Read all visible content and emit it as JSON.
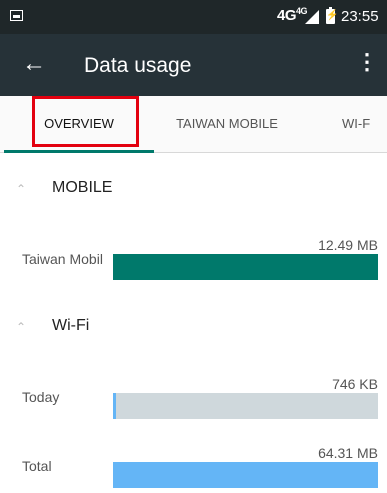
{
  "status_bar": {
    "network": "4G",
    "network_sup": "4G",
    "time": "23:55"
  },
  "app_bar": {
    "title": "Data usage",
    "back_icon": "arrow-back-icon",
    "menu_icon": "more-vert-icon"
  },
  "tabs": [
    {
      "label": "OVERVIEW",
      "active": true
    },
    {
      "label": "TAIWAN MOBILE",
      "active": false
    },
    {
      "label": "WI-F",
      "active": false
    }
  ],
  "mobile": {
    "title": "MOBILE",
    "rows": [
      {
        "label": "Taiwan Mobil",
        "value": "12.49 MB",
        "fraction": 1.0,
        "color": "#00796b"
      }
    ]
  },
  "wifi": {
    "title": "Wi-Fi",
    "rows": [
      {
        "label": "Today",
        "value": "746 KB",
        "fraction": 0.01,
        "color": "#64b5f6",
        "track": "#cfd8dc"
      },
      {
        "label": "Total",
        "value": "64.31 MB",
        "fraction": 1.0,
        "color": "#64b5f6",
        "track": "#cfd8dc"
      }
    ]
  },
  "colors": {
    "accent": "#00796b",
    "highlight": "#e3000f"
  }
}
